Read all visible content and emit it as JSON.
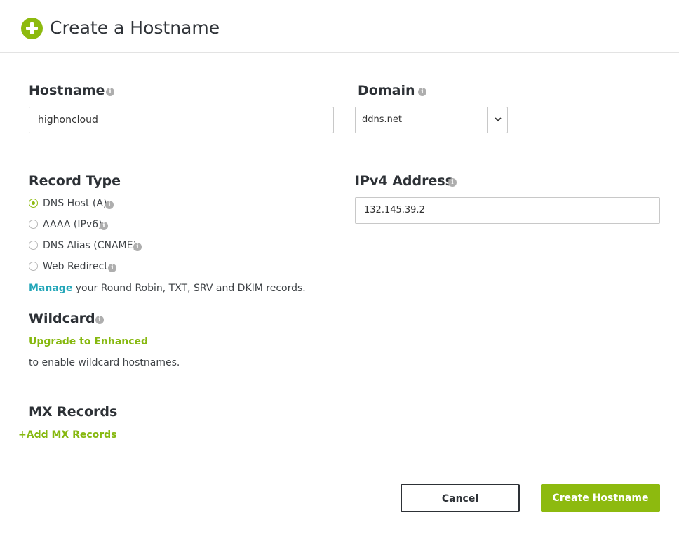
{
  "header": {
    "title": "Create a Hostname",
    "icon": "plus-circle-icon"
  },
  "hostname": {
    "label": "Hostname",
    "value": "highoncloud"
  },
  "domain": {
    "label": "Domain",
    "value": "ddns.net"
  },
  "record_type": {
    "label": "Record Type",
    "options": [
      {
        "label": "DNS Host (A)",
        "checked": true
      },
      {
        "label": "AAAA (IPv6)",
        "checked": false
      },
      {
        "label": "DNS Alias (CNAME)",
        "checked": false
      },
      {
        "label": "Web Redirect",
        "checked": false
      }
    ],
    "manage_link": "Manage",
    "manage_text": "your Round Robin, TXT, SRV and DKIM records."
  },
  "ipv4": {
    "label": "IPv4 Address",
    "value": "132.145.39.2"
  },
  "wildcard": {
    "label": "Wildcard",
    "upgrade_link": "Upgrade to Enhanced",
    "description": "to enable wildcard hostnames."
  },
  "mx": {
    "label": "MX Records",
    "add_link": "Add MX Records"
  },
  "buttons": {
    "cancel": "Cancel",
    "create": "Create Hostname"
  },
  "colors": {
    "accent_green": "#8dba0f",
    "link_teal": "#22a6b8",
    "text_dark": "#2d3136"
  }
}
